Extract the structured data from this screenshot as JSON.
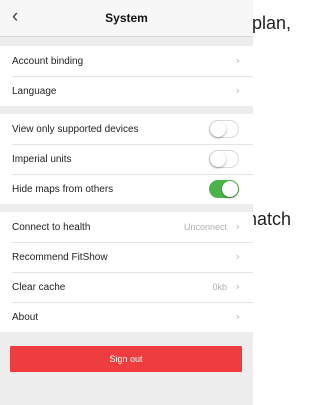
{
  "nav": {
    "title": "System",
    "back_glyph": "‹"
  },
  "groups": [
    {
      "rows": [
        {
          "label": "Account binding",
          "name": "account-binding",
          "type": "link"
        },
        {
          "label": "Language",
          "name": "language",
          "type": "link"
        }
      ]
    },
    {
      "rows": [
        {
          "label": "View only supported devices",
          "name": "view-only-supported-devices",
          "type": "toggle",
          "on": false
        },
        {
          "label": "Imperial units",
          "name": "imperial-units",
          "type": "toggle",
          "on": false
        },
        {
          "label": "Hide maps from others",
          "name": "hide-maps-from-others",
          "type": "toggle",
          "on": true
        }
      ]
    },
    {
      "rows": [
        {
          "label": "Connect to health",
          "name": "connect-to-health",
          "type": "link",
          "value": "Unconnect"
        },
        {
          "label": "Recommend FitShow",
          "name": "recommend-fitshow",
          "type": "link"
        },
        {
          "label": "Clear cache",
          "name": "clear-cache",
          "type": "link",
          "value": "0kb"
        },
        {
          "label": "About",
          "name": "about",
          "type": "link"
        }
      ]
    }
  ],
  "chevron_glyph": "›",
  "signout_label": "Sign out",
  "background_text": {
    "line1": "plan,",
    "line2": "match"
  },
  "colors": {
    "accent_red": "#ef3c3f",
    "toggle_on": "#4cb34a"
  }
}
